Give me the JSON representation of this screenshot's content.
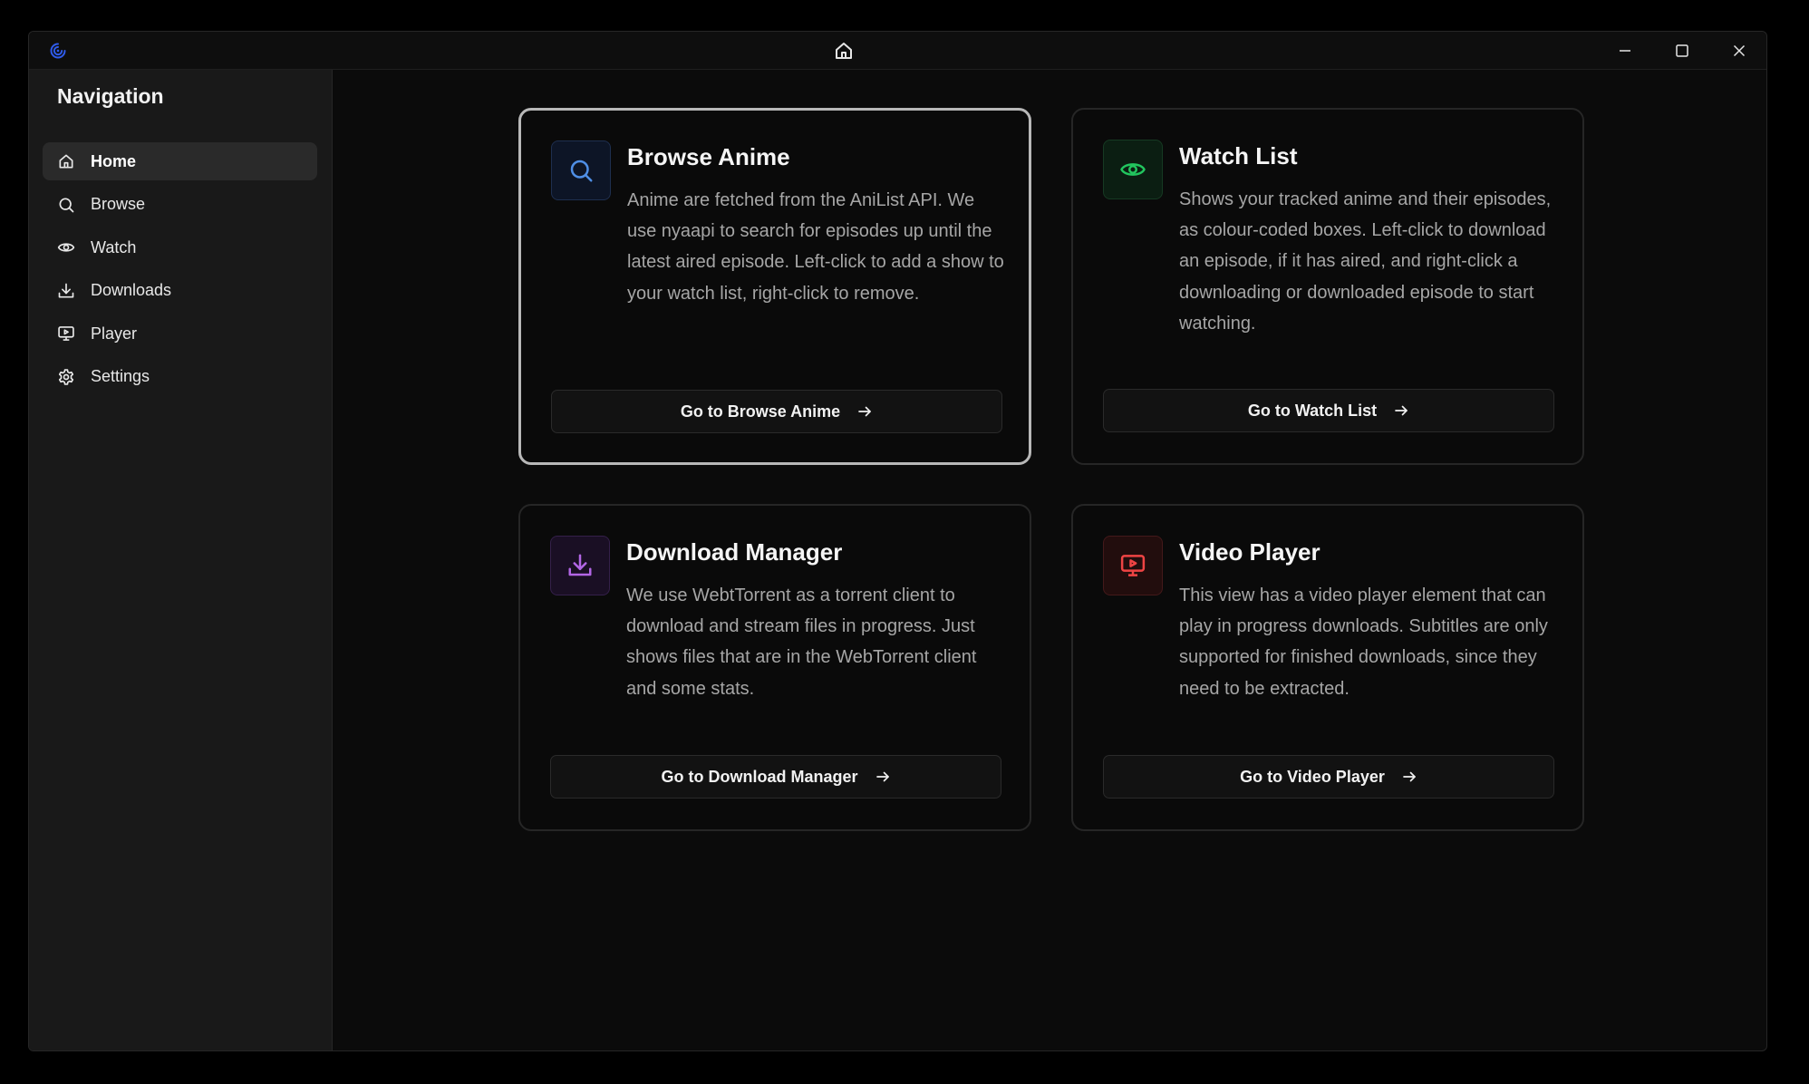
{
  "titlebar": {
    "logo_icon": "app-logo-icon",
    "center_icon": "home-icon",
    "controls": [
      "minimize-icon",
      "maximize-icon",
      "close-icon"
    ]
  },
  "sidebar": {
    "title": "Navigation",
    "items": [
      {
        "label": "Home",
        "icon": "home-icon",
        "active": true
      },
      {
        "label": "Browse",
        "icon": "search-icon",
        "active": false
      },
      {
        "label": "Watch",
        "icon": "eye-icon",
        "active": false
      },
      {
        "label": "Downloads",
        "icon": "download-icon",
        "active": false
      },
      {
        "label": "Player",
        "icon": "monitor-play-icon",
        "active": false
      },
      {
        "label": "Settings",
        "icon": "gear-icon",
        "active": false
      }
    ]
  },
  "cards": [
    {
      "title": "Browse Anime",
      "description": "Anime are fetched from the AniList API. We use nyaapi to search for episodes up until the latest aired episode. Left-click to add a show to your watch list, right-click to remove.",
      "button_label": "Go to Browse Anime",
      "icon": "search-icon",
      "accent": "#4f8fe6"
    },
    {
      "title": "Watch List",
      "description": "Shows your tracked anime and their episodes, as colour-coded boxes. Left-click to download an episode, if it has aired, and right-click a downloading or downloaded episode to start watching.",
      "button_label": "Go to Watch List",
      "icon": "eye-icon",
      "accent": "#22c55e"
    },
    {
      "title": "Download Manager",
      "description": "We use WebtTorrent as a torrent client to download and stream files in progress. Just shows files that are in the WebTorrent client and some stats.",
      "button_label": "Go to Download Manager",
      "icon": "download-icon",
      "accent": "#b366e6"
    },
    {
      "title": "Video Player",
      "description": "This view has a video player element that can play in progress downloads. Subtitles are only supported for finished downloads, since they need to be extracted.",
      "button_label": "Go to Video Player",
      "icon": "monitor-play-icon",
      "accent": "#ef4444"
    }
  ]
}
